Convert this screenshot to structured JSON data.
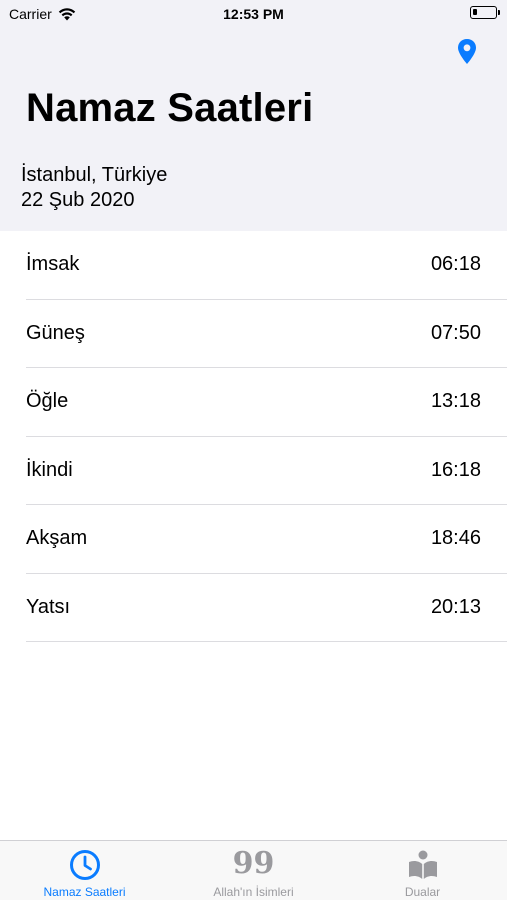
{
  "status_bar": {
    "carrier": "Carrier",
    "time": "12:53 PM",
    "battery_level": 0.2
  },
  "header": {
    "title": "Namaz Saatleri",
    "location": "İstanbul, Türkiye",
    "date": "22 Şub 2020",
    "location_icon": "location-pin-icon"
  },
  "prayer_times": [
    {
      "name": "İmsak",
      "time": "06:18"
    },
    {
      "name": "Güneş",
      "time": "07:50"
    },
    {
      "name": "Öğle",
      "time": "13:18"
    },
    {
      "name": "İkindi",
      "time": "16:18"
    },
    {
      "name": "Akşam",
      "time": "18:46"
    },
    {
      "name": "Yatsı",
      "time": "20:13"
    }
  ],
  "tabbar": {
    "tabs": [
      {
        "label": "Namaz Saatleri",
        "icon": "clock-icon",
        "active": true
      },
      {
        "label": "Allah'ın İsimleri",
        "icon_text": "99",
        "active": false
      },
      {
        "label": "Dualar",
        "icon": "reading-book-icon",
        "active": false
      }
    ]
  },
  "colors": {
    "accent": "#0a7cff",
    "header_bg": "#f2f2f7",
    "inactive": "#9a9a9e"
  }
}
